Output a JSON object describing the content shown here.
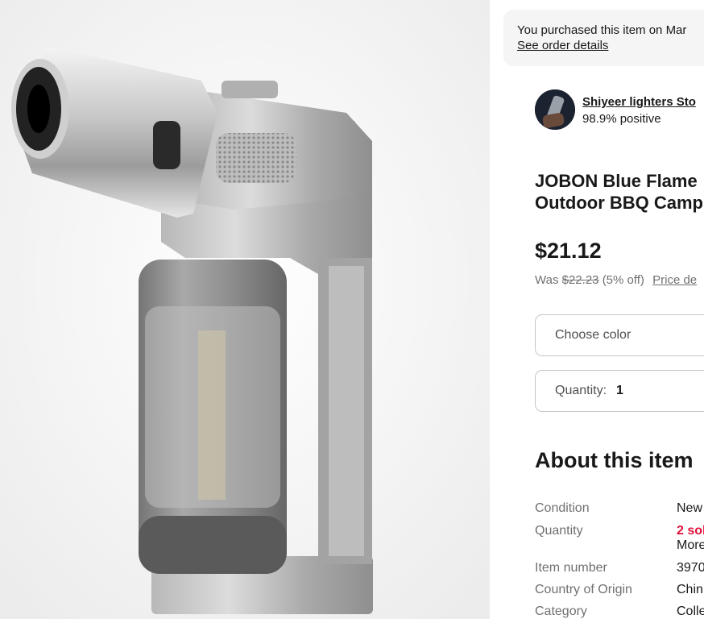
{
  "product_image": {
    "alt": "JOBON Blue Flame torch lighter, silver"
  },
  "purchase_notice": {
    "text": "You purchased this item on Mar",
    "link": "See order details"
  },
  "seller": {
    "name": "Shiyeer lighters Sto",
    "rating": "98.9% positive"
  },
  "listing": {
    "title_line1": "JOBON Blue Flame",
    "title_line2": "Outdoor BBQ Camp",
    "price": "$21.12",
    "was_label": "Was",
    "was_price": "$22.23",
    "discount": "(5% off)",
    "price_details_link": "Price de"
  },
  "color_select": {
    "placeholder": "Choose color"
  },
  "quantity_field": {
    "label": "Quantity:",
    "value": "1"
  },
  "about": {
    "heading": "About this item",
    "specs": [
      {
        "label": "Condition",
        "value": "New"
      },
      {
        "label": "Quantity",
        "value": "2 sol",
        "value2": "More"
      },
      {
        "label": "Item number",
        "value": "3970"
      },
      {
        "label": "Country of Origin",
        "value": "Chin"
      },
      {
        "label": "Category",
        "value": "Colle"
      }
    ]
  },
  "colors": {
    "accent_red": "#e0103a",
    "text": "#191919",
    "muted": "#707070"
  }
}
